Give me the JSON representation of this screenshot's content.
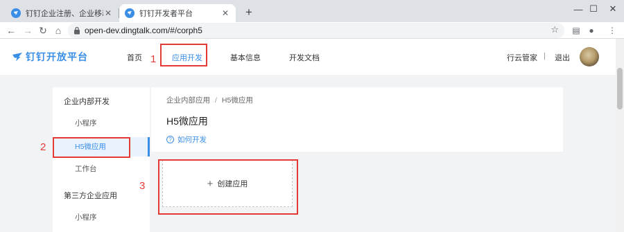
{
  "browser": {
    "tabs": [
      {
        "title": "钉钉企业注册、企业移动办公、全",
        "active": false
      },
      {
        "title": "钉钉开发者平台",
        "active": true
      }
    ],
    "url": "open-dev.dingtalk.com/#/corph5"
  },
  "header": {
    "logo_text": "钉钉开放平台",
    "nav": [
      "首页",
      "应用开发",
      "基本信息",
      "开发文档"
    ],
    "right_links": [
      "行云管家",
      "|",
      "退出"
    ]
  },
  "sidebar": {
    "group1": "企业内部开发",
    "items1": [
      "小程序",
      "H5微应用",
      "工作台"
    ],
    "group2": "第三方企业应用",
    "items2": [
      "小程序"
    ]
  },
  "content": {
    "breadcrumb": [
      "企业内部应用",
      "/",
      "H5微应用"
    ],
    "title": "H5微应用",
    "help_link": "如何开发",
    "create_label": "创建应用"
  },
  "annotations": [
    "1",
    "2",
    "3"
  ],
  "colors": {
    "accent": "#3a8ee6",
    "annotation": "#e53935"
  }
}
